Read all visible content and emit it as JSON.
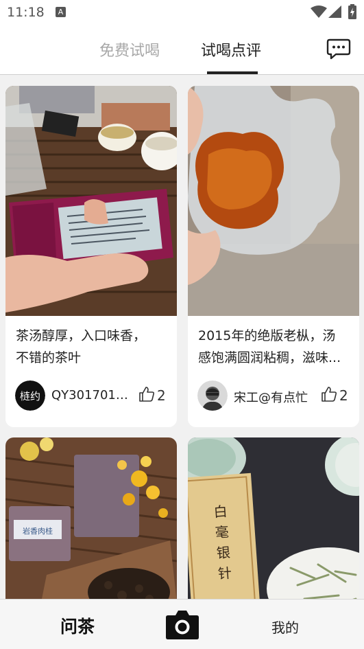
{
  "status_bar": {
    "time": "11:18",
    "notification_icon": "A"
  },
  "header": {
    "tabs": [
      {
        "label": "免费试喝",
        "active": false
      },
      {
        "label": "试喝点评",
        "active": true
      }
    ],
    "message_icon": "chat-bubble-icon"
  },
  "posts": [
    {
      "text_line1": "茶汤醇厚，入口味香，",
      "text_line2": "不错的茶叶",
      "author": "QY3017015...",
      "avatar_text": "梿约",
      "likes": "2"
    },
    {
      "text_line1": "2015年的绝版老枞，汤",
      "text_line2": "感饱满圆润粘稠，滋味...",
      "author": "宋工@有点忙",
      "likes": "2"
    },
    {
      "package_label": "岩香肉桂"
    },
    {
      "package_label": "白毫银针"
    }
  ],
  "bottom_nav": {
    "left": "问茶",
    "center_icon": "camera-icon",
    "right": "我的"
  },
  "colors": {
    "active_text": "#222222",
    "inactive_text": "#a8a8a8",
    "background": "#f1f1f1"
  }
}
